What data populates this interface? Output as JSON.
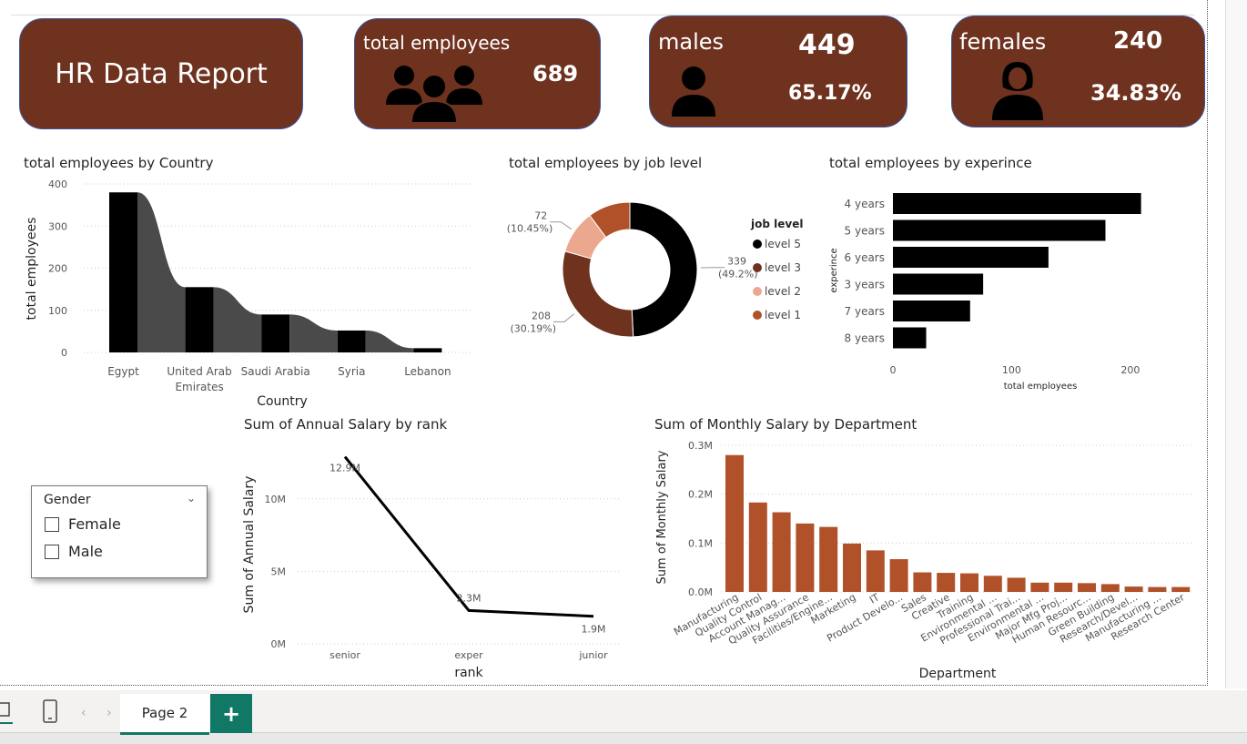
{
  "report_title": "HR Data Report",
  "kpi": {
    "total": {
      "label": "total employees",
      "value": "689"
    },
    "males": {
      "label": "males",
      "value": "449",
      "pct": "65.17%"
    },
    "females": {
      "label": "females",
      "value": "240",
      "pct": "34.83%"
    }
  },
  "colors": {
    "card": "#6e321f",
    "accent": "#b0512a",
    "dark": "#000000",
    "gray": "#4a4a4a",
    "tab": "#117865"
  },
  "icons": {
    "group": "people-group-icon",
    "male": "person-icon",
    "female": "woman-icon"
  },
  "slicer": {
    "title": "Gender",
    "options": [
      "Female",
      "Male"
    ]
  },
  "tabs": {
    "page": "Page 2",
    "add": "+"
  },
  "chart_data": [
    {
      "id": "country",
      "type": "bar",
      "title": "total employees by Country",
      "xlabel": "Country",
      "ylabel": "total employees",
      "categories": [
        "Egypt",
        "United Arab Emirates",
        "Saudi Arabia",
        "Syria",
        "Lebanon"
      ],
      "values": [
        380,
        155,
        90,
        52,
        10
      ],
      "ylim": [
        0,
        400
      ],
      "yticks": [
        0,
        100,
        200,
        300,
        400
      ],
      "grid": true
    },
    {
      "id": "joblevel",
      "type": "pie",
      "title": "total employees by job level",
      "legend_title": "job level",
      "legend_placement": "right",
      "slices": [
        {
          "name": "level 5",
          "value": 339,
          "label": "339",
          "pct": "(49.2%)",
          "color": "#000000"
        },
        {
          "name": "level 3",
          "value": 208,
          "label": "208",
          "pct": "(30.19%)",
          "color": "#6e321f"
        },
        {
          "name": "level 2",
          "value": 72,
          "label": "72",
          "pct": "(10.45%)",
          "color": "#eca88e"
        },
        {
          "name": "level 1",
          "value": 70,
          "label": "",
          "pct": "",
          "color": "#b0512a"
        }
      ]
    },
    {
      "id": "experience",
      "type": "bar",
      "orientation": "horizontal",
      "title": "total employees by experince",
      "xlabel": "total employees",
      "ylabel": "experince",
      "categories": [
        "4 years",
        "5 years",
        "6 years",
        "3 years",
        "7 years",
        "8 years"
      ],
      "values": [
        209,
        179,
        131,
        76,
        65,
        28
      ],
      "xlim": [
        0,
        230
      ],
      "xticks": [
        0,
        100,
        200
      ]
    },
    {
      "id": "rank",
      "type": "line",
      "title": "Sum of Annual Salary by rank",
      "xlabel": "rank",
      "ylabel": "Sum of Annual Salary",
      "categories": [
        "senior",
        "exper",
        "junior"
      ],
      "values": [
        12.9,
        2.3,
        1.9
      ],
      "value_labels": [
        "12.9M",
        "2.3M",
        "1.9M"
      ],
      "ylim": [
        0,
        13
      ],
      "yticks": [
        0,
        5,
        10
      ],
      "ytick_labels": [
        "0M",
        "5M",
        "10M"
      ]
    },
    {
      "id": "department",
      "type": "bar",
      "title": "Sum of Monthly Salary by Department",
      "xlabel": "Department",
      "ylabel": "Sum of Monthly Salary",
      "categories": [
        "Manufacturing",
        "Quality Control",
        "Account Manag...",
        "Quality Assurance",
        "Facilities/Engine...",
        "Marketing",
        "IT",
        "Product Develo...",
        "Sales",
        "Creative",
        "Training",
        "Environmental ...",
        "Professional Trai...",
        "Environmental ...",
        "Major Mfg Proj...",
        "Human Resourc...",
        "Green Building",
        "Research/Devel...",
        "Manufacturing ...",
        "Research Center"
      ],
      "values": [
        0.28,
        0.183,
        0.163,
        0.14,
        0.133,
        0.099,
        0.085,
        0.067,
        0.04,
        0.039,
        0.038,
        0.033,
        0.029,
        0.019,
        0.019,
        0.018,
        0.016,
        0.011,
        0.01,
        0.01
      ],
      "ylim": [
        0,
        0.3
      ],
      "yticks": [
        0,
        0.1,
        0.2,
        0.3
      ],
      "ytick_labels": [
        "0.0M",
        "0.1M",
        "0.2M",
        "0.3M"
      ]
    }
  ]
}
